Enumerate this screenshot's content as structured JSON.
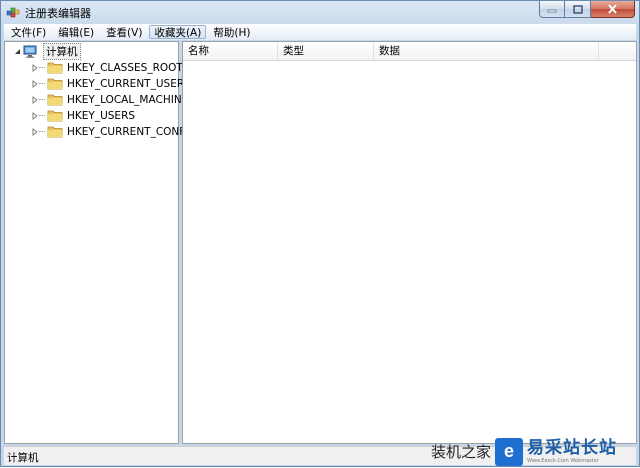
{
  "window": {
    "title": "注册表编辑器"
  },
  "menu": {
    "items": [
      {
        "label": "文件(F)"
      },
      {
        "label": "编辑(E)"
      },
      {
        "label": "查看(V)"
      },
      {
        "label": "收藏夹(A)"
      },
      {
        "label": "帮助(H)"
      }
    ],
    "active_index": 3
  },
  "tree": {
    "root": {
      "label": "计算机",
      "icon": "computer-icon",
      "expanded": true
    },
    "children": [
      {
        "label": "HKEY_CLASSES_ROOT",
        "icon": "folder-icon"
      },
      {
        "label": "HKEY_CURRENT_USER",
        "icon": "folder-icon"
      },
      {
        "label": "HKEY_LOCAL_MACHINE",
        "icon": "folder-icon"
      },
      {
        "label": "HKEY_USERS",
        "icon": "folder-icon"
      },
      {
        "label": "HKEY_CURRENT_CONFIG",
        "icon": "folder-icon"
      }
    ]
  },
  "list": {
    "columns": [
      {
        "label": "名称"
      },
      {
        "label": "类型"
      },
      {
        "label": "数据"
      }
    ]
  },
  "status": {
    "path": "计算机"
  },
  "watermark": {
    "text": "装机之家",
    "brand": "易采站长站",
    "brand_sub": "Www.Easck.Com Webmaster",
    "logo_letter": "e"
  },
  "colors": {
    "folder": "#e8c35a",
    "accent": "#1e6fd0"
  }
}
